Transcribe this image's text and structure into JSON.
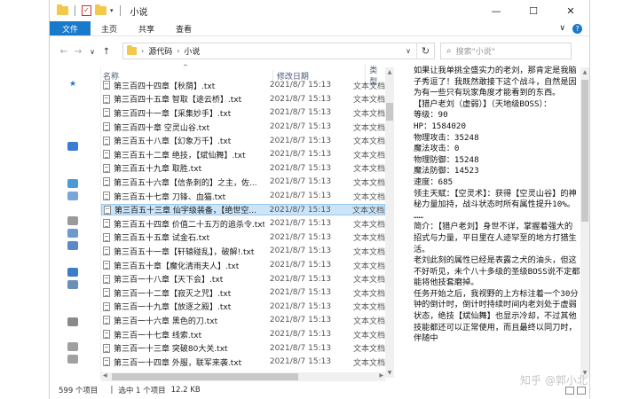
{
  "window": {
    "title": "小说",
    "controls": {
      "minimize": "—",
      "maximize": "☐",
      "close": "✕"
    }
  },
  "ribbon": {
    "tabs": [
      "文件",
      "主页",
      "共享",
      "查看"
    ],
    "expand": "∨",
    "help": "?"
  },
  "nav": {
    "back": "←",
    "forward": "→",
    "recent": "∨",
    "up": "↑",
    "breadcrumb": [
      "源代码",
      "小说"
    ],
    "dropdown": "∨",
    "refresh": "↻",
    "search_placeholder": "搜索\"小说\""
  },
  "columns": {
    "name": "名称",
    "date": "修改日期",
    "type": "类型"
  },
  "files": [
    {
      "name": "第三百四十四章【秋荫】.txt",
      "date": "2021/8/7 15:13",
      "type": "文本文档"
    },
    {
      "name": "第三百四十五章 智取【途云桥】.txt",
      "date": "2021/8/7 15:13",
      "type": "文本文档"
    },
    {
      "name": "第三百四十一章【采集妙手】.txt",
      "date": "2021/8/7 15:13",
      "type": "文本文档"
    },
    {
      "name": "第三百四十章 空灵山谷.txt",
      "date": "2021/8/7 15:13",
      "type": "文本文档"
    },
    {
      "name": "第三百五十八章【幻象万千】.txt",
      "date": "2021/8/7 15:13",
      "type": "文本文档"
    },
    {
      "name": "第三百五十二章 绝技，【斌仙舞】.txt",
      "date": "2021/8/7 15:13",
      "type": "文本文档"
    },
    {
      "name": "第三百五十九章 取胜.txt",
      "date": "2021/8/7 15:13",
      "type": "文本文档"
    },
    {
      "name": "第三百五十六章【信条刺的】之主，佐...",
      "date": "2021/8/7 15:13",
      "type": "文本文档"
    },
    {
      "name": "第三百五十七章 刀锋、血猫.txt",
      "date": "2021/8/7 15:13",
      "type": "文本文档"
    },
    {
      "name": "第三百五十三章 仙宇级装备，【绝世空...",
      "date": "2021/8/7 15:13",
      "type": "文本文档",
      "selected": true
    },
    {
      "name": "第三百五十四章 价值二十五万的追杀令.txt",
      "date": "2021/8/7 15:13",
      "type": "文本文档"
    },
    {
      "name": "第三百五十五章 试金石.txt",
      "date": "2021/8/7 15:13",
      "type": "文本文档"
    },
    {
      "name": "第三百五十一章【轩辕碰乱】，破解!.txt",
      "date": "2021/8/7 15:13",
      "type": "文本文档"
    },
    {
      "name": "第三百五十章【魔化清雨夫人】.txt",
      "date": "2021/8/7 15:13",
      "type": "文本文档"
    },
    {
      "name": "第三百一十八章【天下会】.txt",
      "date": "2021/8/7 15:13",
      "type": "文本文档"
    },
    {
      "name": "第三百一十二章【寂灭之咒】.txt",
      "date": "2021/8/7 15:13",
      "type": "文本文档"
    },
    {
      "name": "第三百一十九章【放逐之殿】.txt",
      "date": "2021/8/7 15:13",
      "type": "文本文档"
    },
    {
      "name": "第三百一十六章 黑色的刀.txt",
      "date": "2021/8/7 15:13",
      "type": "文本文档"
    },
    {
      "name": "第三百一十七章 线索.txt",
      "date": "2021/8/7 15:13",
      "type": "文本文档"
    },
    {
      "name": "第三百一十三章 突破80大关.txt",
      "date": "2021/8/7 15:13",
      "type": "文本文档"
    },
    {
      "name": "第三百一十四章 外服，联军来袭.txt",
      "date": "2021/8/7 15:13",
      "type": "文本文档"
    }
  ],
  "preview": [
    "如果让我单挑全盛实力的老刘，那肯定是我脑子秀逗了！我既然敢接下这个战斗，自然是因为有一些只有玩家角度才能看到的东西。",
    "【猎户老刘（虚弱）】（天地级BOSS）：",
    "等级：90",
    "HP：1584020",
    "物理攻击：35248",
    "魔法攻击：0",
    "物理防御：15248",
    "魔法防御：14523",
    "速度：685",
    "领主天赋：【空灵术】：获得【空灵山谷】的神秘力量加持，战斗状态时所有属性提升10%。",
    "……",
    "简介：【猎户老刘】身世不详，掌握着强大的招式与力量，平日里在人迹罕至的地方打猎生活。",
    "老刘此刻的属性已经是表露之犬的油头，但这不好听见，未个八十多级的圣级BOSS说不定都能将他技套磨掉。",
    "任务开始之后，我视野的上方标注着一个30分钟的倒计时，倒计时持续时间内老刘处于虚弱状态，绝技【斌仙舞】也显示冷却，不过其他技能都还可以正常使用，而且最终以同刀时，伴随中"
  ],
  "status": {
    "count": "599 个项目",
    "selected": "选中 1 个项目",
    "size": "12.2 KB"
  },
  "watermark": "知乎 @郭小北"
}
